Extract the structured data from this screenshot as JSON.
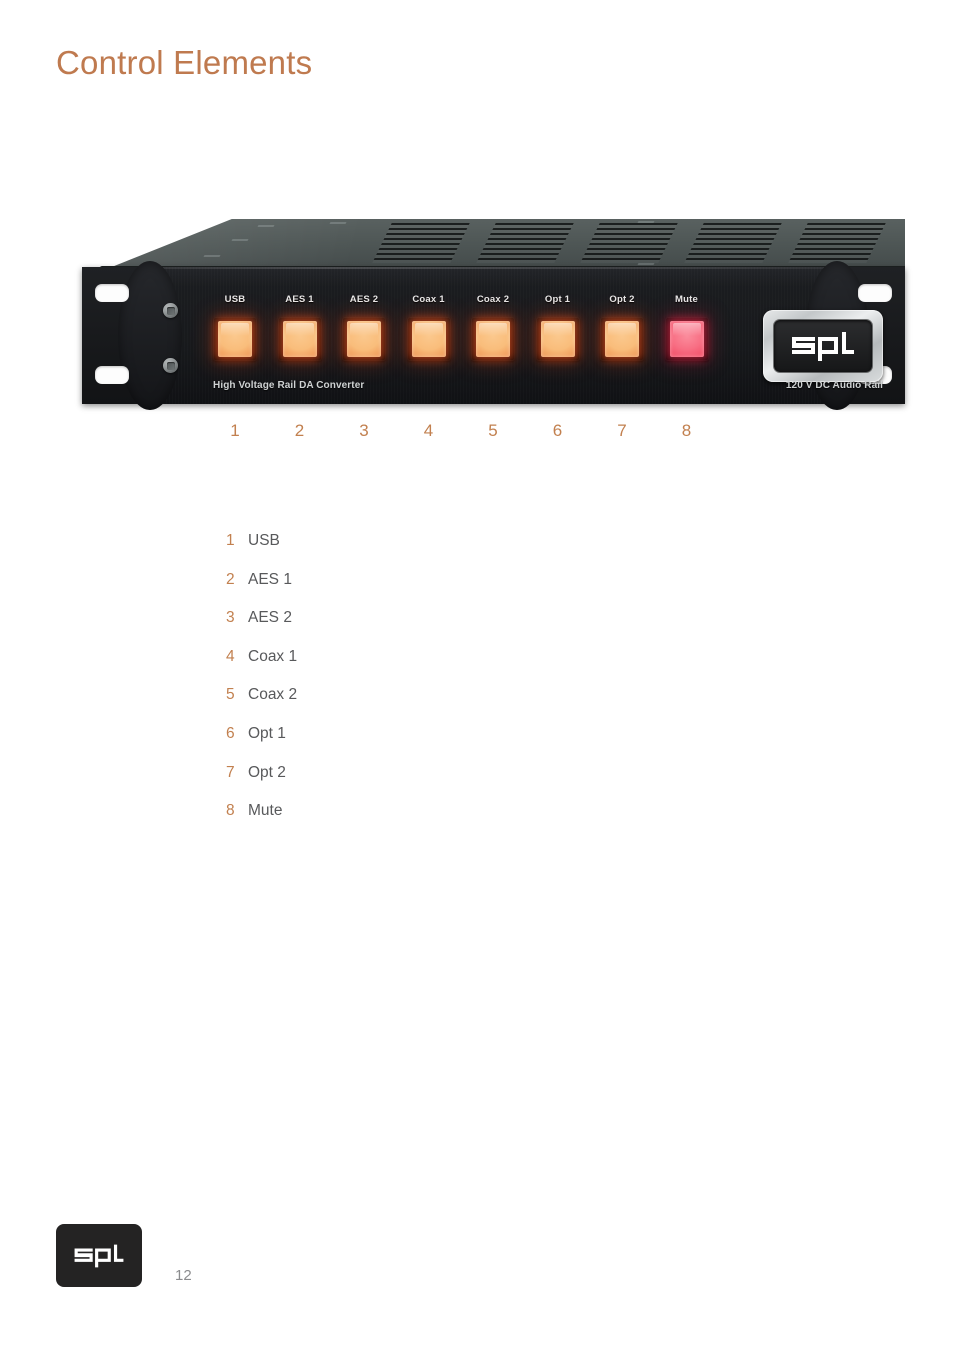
{
  "header": {
    "title": "Control Elements"
  },
  "device": {
    "brand_badge": "spl",
    "caption_left": "High Voltage Rail DA Converter",
    "caption_right": "120 V DC Audio Rail",
    "buttons": [
      {
        "label": "USB",
        "state": "lit",
        "color": "#f9bd7b"
      },
      {
        "label": "AES 1",
        "state": "lit",
        "color": "#f9bd7b"
      },
      {
        "label": "AES 2",
        "state": "lit",
        "color": "#f9bd7b"
      },
      {
        "label": "Coax 1",
        "state": "lit",
        "color": "#f9bd7b"
      },
      {
        "label": "Coax 2",
        "state": "lit",
        "color": "#f9bd7b"
      },
      {
        "label": "Opt 1",
        "state": "lit",
        "color": "#f9bd7b"
      },
      {
        "label": "Opt 2",
        "state": "lit",
        "color": "#f9bd7b"
      },
      {
        "label": "Mute",
        "state": "lit",
        "color": "#f86f84"
      }
    ]
  },
  "callouts": [
    "1",
    "2",
    "3",
    "4",
    "5",
    "6",
    "7",
    "8"
  ],
  "legend": [
    {
      "num": "1",
      "label": "USB"
    },
    {
      "num": "2",
      "label": "AES 1"
    },
    {
      "num": "3",
      "label": "AES 2"
    },
    {
      "num": "4",
      "label": "Coax 1"
    },
    {
      "num": "5",
      "label": "Coax 2"
    },
    {
      "num": "6",
      "label": "Opt 1"
    },
    {
      "num": "7",
      "label": "Opt 2"
    },
    {
      "num": "8",
      "label": "Mute"
    }
  ],
  "footer": {
    "logo": "spl",
    "page_number": "12"
  },
  "colors": {
    "accent": "#bf7a4f",
    "callout": "#c2804f",
    "body_text": "#58595b",
    "page_number": "#8b8c8e",
    "faceplate": "#17191c",
    "lid": "#4e5655"
  }
}
